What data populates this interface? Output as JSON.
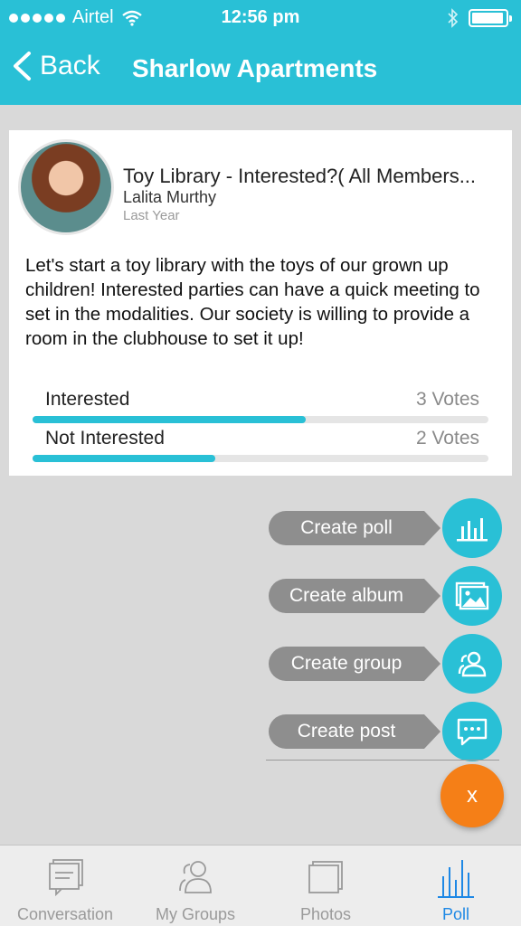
{
  "status_bar": {
    "carrier": "Airtel",
    "time": "12:56 pm"
  },
  "nav": {
    "back_label": "Back",
    "title": "Sharlow Apartments"
  },
  "post": {
    "title": "Toy Library - Interested?( All Members...",
    "author": "Lalita Murthy",
    "time": "Last Year",
    "body": "Let's start a toy library with the toys of our grown up children! Interested parties can have a quick meeting to set in the modalities. Our society is willing to provide a room in the clubhouse to set it up!",
    "options": [
      {
        "label": "Interested",
        "votes_text": "3  Votes",
        "fraction": 0.6
      },
      {
        "label": "Not Interested",
        "votes_text": "2  Votes",
        "fraction": 0.4
      }
    ]
  },
  "actions": [
    {
      "label": "Create poll",
      "icon": "bar-chart-icon"
    },
    {
      "label": "Create album",
      "icon": "image-icon"
    },
    {
      "label": "Create group",
      "icon": "group-icon"
    },
    {
      "label": "Create post",
      "icon": "chat-icon"
    }
  ],
  "close_label": "x",
  "tabs": [
    {
      "label": "Conversation",
      "icon": "conversation-icon",
      "active": false
    },
    {
      "label": "My Groups",
      "icon": "groups-icon",
      "active": false
    },
    {
      "label": "Photos",
      "icon": "photos-icon",
      "active": false
    },
    {
      "label": "Poll",
      "icon": "poll-icon",
      "active": true
    }
  ],
  "colors": {
    "accent": "#29c0d6",
    "fab": "#f57f17",
    "active_tab": "#1e88e5"
  }
}
